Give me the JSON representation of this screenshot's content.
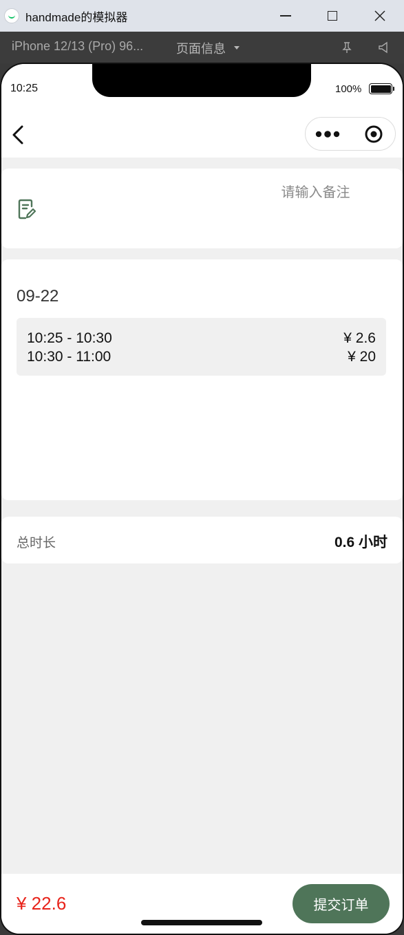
{
  "window": {
    "title": "handmade的模拟器",
    "device": "iPhone 12/13 (Pro) 96...",
    "page_info": "页面信息"
  },
  "status_bar": {
    "time": "10:25",
    "battery": "100%"
  },
  "remark": {
    "placeholder": "请输入备注",
    "value": ""
  },
  "schedule": {
    "date": "09-22",
    "slots": [
      {
        "time": "10:25 - 10:30",
        "price": "¥ 2.6"
      },
      {
        "time": "10:30 - 11:00",
        "price": "¥ 20"
      }
    ]
  },
  "duration": {
    "label": "总时长",
    "value": "0.6 小时"
  },
  "footer": {
    "total": "¥ 22.6",
    "submit_label": "提交订单"
  },
  "colors": {
    "accent": "#4f7559",
    "price": "#e8231a",
    "background": "#f0f0f0"
  }
}
